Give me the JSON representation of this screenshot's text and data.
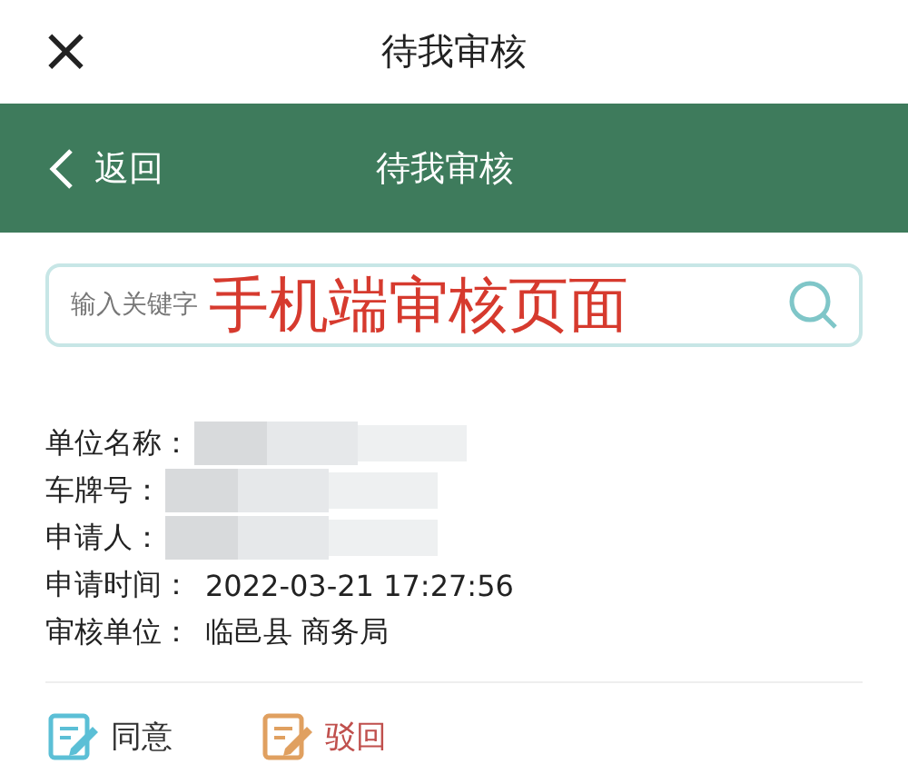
{
  "top_bar": {
    "close": "×",
    "title": "待我审核"
  },
  "nav_bar": {
    "back": "返回",
    "title": "待我审核"
  },
  "search": {
    "placeholder": "输入关键字",
    "annotation": "手机端审核页面"
  },
  "fields": [
    {
      "label": "单位名称：",
      "kind": "redacted"
    },
    {
      "label": "车牌号：",
      "kind": "redacted"
    },
    {
      "label": "申请人：",
      "kind": "redacted"
    },
    {
      "label": "申请时间：",
      "kind": "text",
      "value": "2022-03-21 17:27:56"
    },
    {
      "label": "审核单位：",
      "kind": "text",
      "value": "临邑县 商务局"
    }
  ],
  "actions": [
    {
      "label": "同意",
      "color": "#5bbfd6"
    },
    {
      "label": "驳回",
      "color": "#e0a060"
    }
  ]
}
